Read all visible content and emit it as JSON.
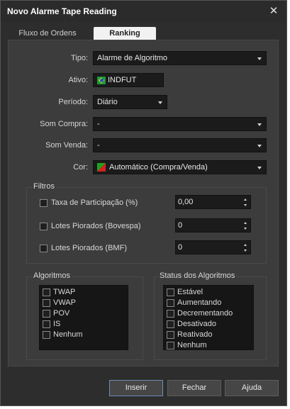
{
  "window": {
    "title": "Novo Alarme Tape Reading",
    "close_glyph": "✕"
  },
  "tabs": [
    {
      "label": "Fluxo de Ordens"
    },
    {
      "label": "Ranking"
    }
  ],
  "form": {
    "tipo": {
      "label": "Tipo:",
      "value": "Alarme de Algoritmo"
    },
    "ativo": {
      "label": "Ativo:",
      "value": "INDFUT"
    },
    "periodo": {
      "label": "Período:",
      "value": "Diário"
    },
    "som_compra": {
      "label": "Som Compra:",
      "value": "-"
    },
    "som_venda": {
      "label": "Som Venda:",
      "value": "-"
    },
    "cor": {
      "label": "Cor:",
      "value": "Automático (Compra/Venda)"
    }
  },
  "filtros": {
    "title": "Filtros",
    "items": [
      {
        "label": "Taxa de Participação (%)",
        "value": "0,00"
      },
      {
        "label": "Lotes Piorados (Bovespa)",
        "value": "0"
      },
      {
        "label": "Lotes Piorados (BMF)",
        "value": "0"
      }
    ]
  },
  "algoritmos": {
    "title": "Algoritmos",
    "items": [
      "TWAP",
      "VWAP",
      "POV",
      "IS",
      "Nenhum"
    ]
  },
  "status": {
    "title": "Status dos Algoritmos",
    "items": [
      "Estável",
      "Aumentando",
      "Decrementando",
      "Desativado",
      "Reativado",
      "Nenhum"
    ]
  },
  "buttons": {
    "inserir": "Inserir",
    "fechar": "Fechar",
    "ajuda": "Ajuda"
  },
  "colors": {
    "background": "#2d2d2d",
    "panel": "#3c3c3c",
    "field": "#1b1b1b",
    "primary_border": "#6a8fb5"
  }
}
